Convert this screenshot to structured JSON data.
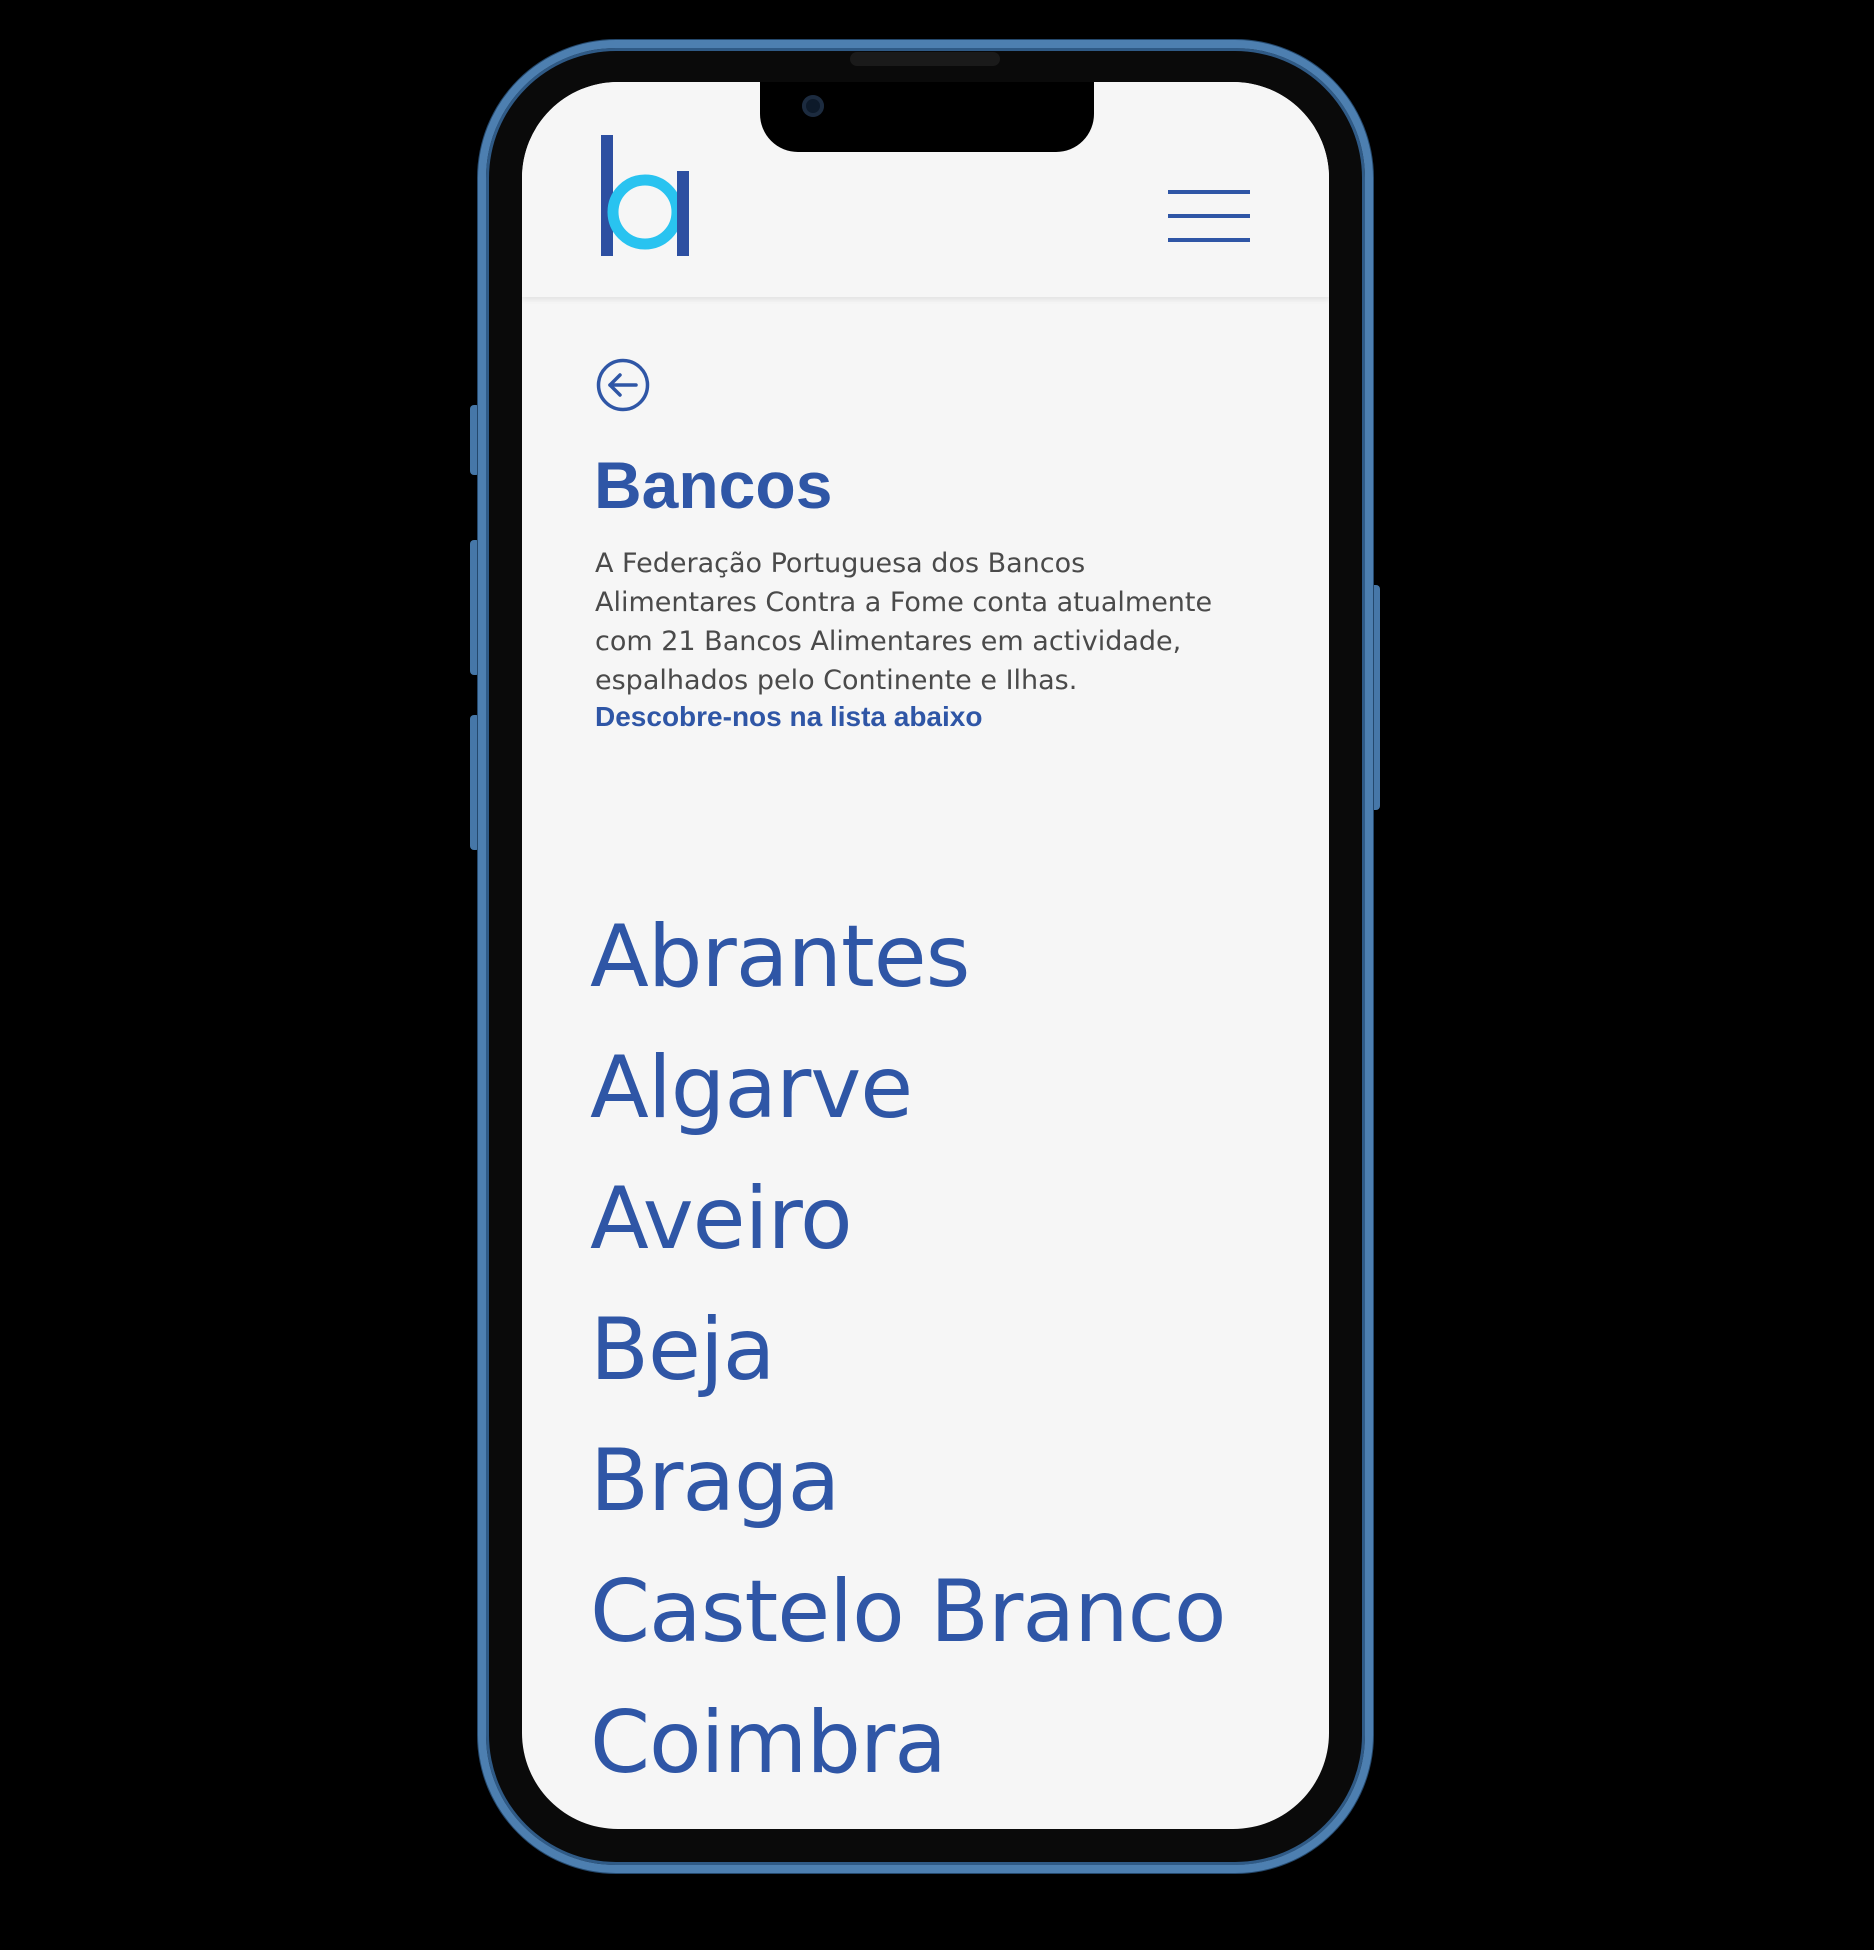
{
  "header": {
    "logo_icon": "ba-logo-icon",
    "menu_icon": "hamburger-menu-icon"
  },
  "colors": {
    "brand_blue": "#2f56a6",
    "logo_light_blue": "#29c3f0",
    "logo_dark_blue": "#2d4fa1",
    "frame_blue": "#4d7fb0",
    "page_background": "#f6f6f6",
    "body_text": "#4a4a4a"
  },
  "main": {
    "back_icon": "arrow-left-circle-icon",
    "title": "Bancos",
    "intro_lines": [
      "A Federação Portuguesa dos Bancos",
      "Alimentares Contra a Fome conta atualmente",
      "com 21 Bancos Alimentares em actividade,",
      "espalhados pelo Continente e Ilhas."
    ],
    "intro_link": "Descobre-nos na lista abaixo",
    "banks": [
      "Abrantes",
      "Algarve",
      "Aveiro",
      "Beja",
      "Braga",
      "Castelo Branco",
      "Coimbra"
    ]
  }
}
